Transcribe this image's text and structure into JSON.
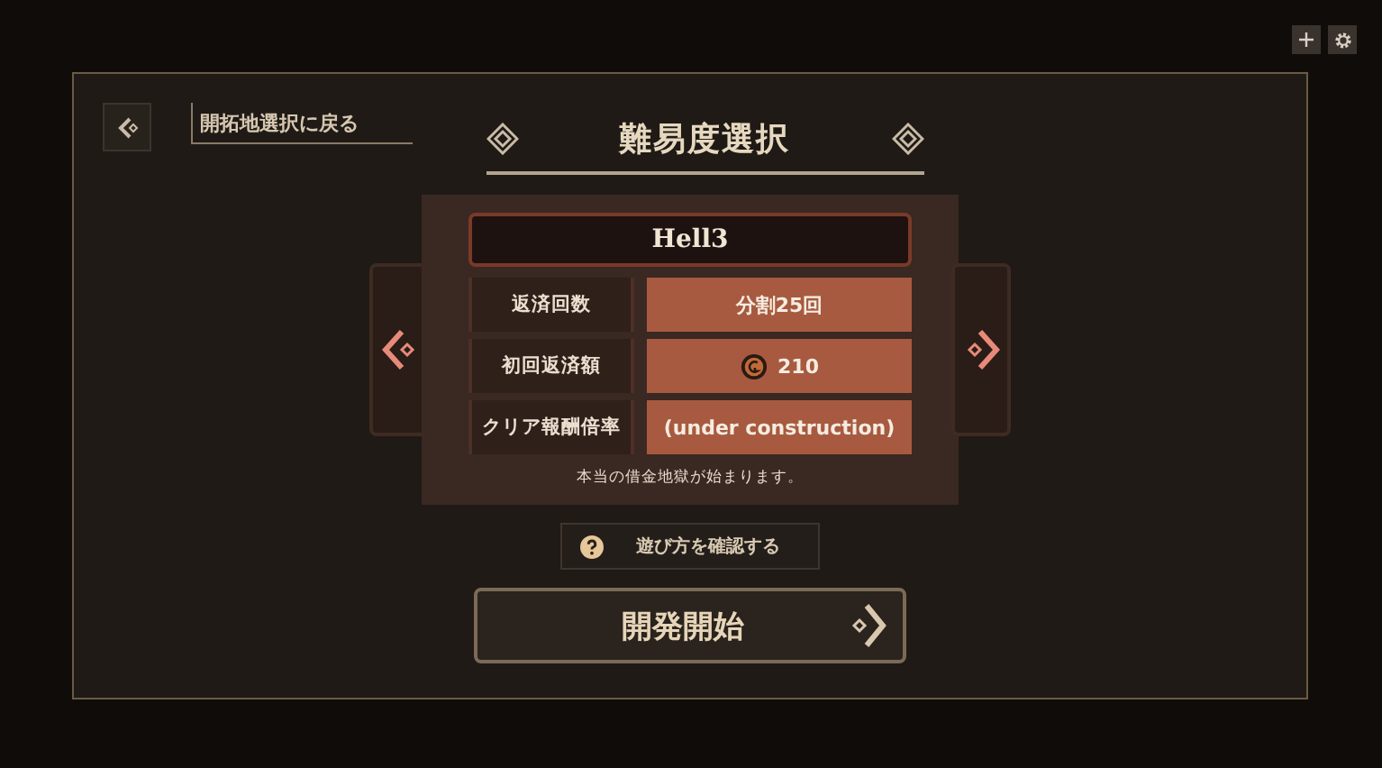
{
  "back_link": {
    "label": "開拓地選択に戻る"
  },
  "title": "難易度選択",
  "difficulty": {
    "name": "Hell3",
    "rows": [
      {
        "label": "返済回数",
        "value": "分割25回",
        "kind": "text"
      },
      {
        "label": "初回返済額",
        "value": "210",
        "kind": "coin"
      },
      {
        "label": "クリア報酬倍率",
        "value": "(under construction)",
        "kind": "text"
      }
    ],
    "note": "本当の借金地獄が始まります。"
  },
  "help_button": {
    "label": "遊び方を確認する"
  },
  "start_button": {
    "label": "開発開始"
  }
}
